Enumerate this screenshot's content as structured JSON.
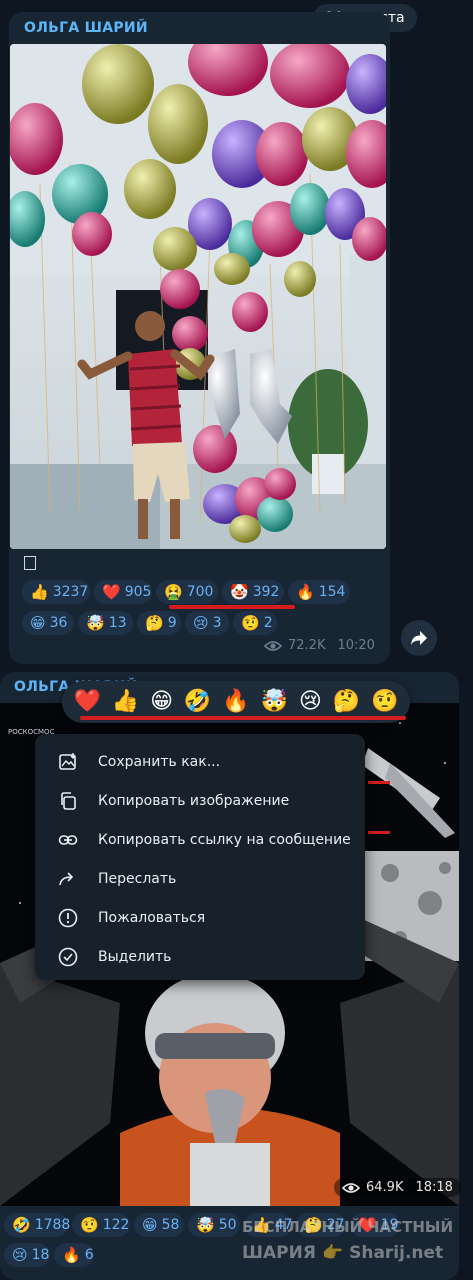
{
  "date_pill": "20 августа",
  "post1": {
    "author": "ОЛЬГА ШАРИЙ",
    "text": "▯",
    "reactions_row1": [
      {
        "emoji": "👍",
        "count": "3237"
      },
      {
        "emoji": "❤️",
        "count": "905"
      },
      {
        "emoji": "🤮",
        "count": "700"
      },
      {
        "emoji": "🤡",
        "count": "392"
      },
      {
        "emoji": "🔥",
        "count": "154"
      }
    ],
    "reactions_row2": [
      {
        "emoji": "😁",
        "count": "36"
      },
      {
        "emoji": "🤯",
        "count": "13"
      },
      {
        "emoji": "🤔",
        "count": "9"
      },
      {
        "emoji": "😢",
        "count": "3"
      },
      {
        "emoji": "🤨",
        "count": "2"
      }
    ],
    "views": "72.2K",
    "time": "10:20"
  },
  "post2": {
    "author": "ОЛЬГА ШАРИЙ",
    "views": "64.9K",
    "time": "18:18",
    "photo_logo_text": "РОСКОСМОС",
    "reactions_row1": [
      {
        "emoji": "🤣",
        "count": "1788"
      },
      {
        "emoji": "🤨",
        "count": "122"
      },
      {
        "emoji": "😁",
        "count": "58"
      },
      {
        "emoji": "🤯",
        "count": "50"
      },
      {
        "emoji": "👍",
        "count": "47"
      },
      {
        "emoji": "🤔",
        "count": "27"
      },
      {
        "emoji": "❤️",
        "count": "19"
      }
    ],
    "reactions_row2": [
      {
        "emoji": "😢",
        "count": "18"
      },
      {
        "emoji": "🔥",
        "count": "6"
      }
    ]
  },
  "reaction_picker": [
    "❤️",
    "👍",
    "😁",
    "🤣",
    "🔥",
    "🤯",
    "😢",
    "🤔",
    "🤨"
  ],
  "context_menu": {
    "items": [
      {
        "icon": "save-image-icon",
        "label": "Сохранить как..."
      },
      {
        "icon": "copy-icon",
        "label": "Копировать изображение"
      },
      {
        "icon": "link-icon",
        "label": "Копировать ссылку на сообщение"
      },
      {
        "icon": "forward-icon",
        "label": "Переслать"
      },
      {
        "icon": "report-icon",
        "label": "Пожаловаться"
      },
      {
        "icon": "select-icon",
        "label": "Выделить"
      }
    ]
  },
  "watermark": {
    "line1": "БЕСПЛАТНЫЙ ЧАСТНЫЙ",
    "line2": "ШАРИЯ",
    "hand": "👉",
    "site": "Sharij.net"
  },
  "colors": {
    "accent": "#6ab3f3",
    "bubble": "#182533",
    "background": "#0e1621",
    "highlight_red": "#d61d1d"
  }
}
